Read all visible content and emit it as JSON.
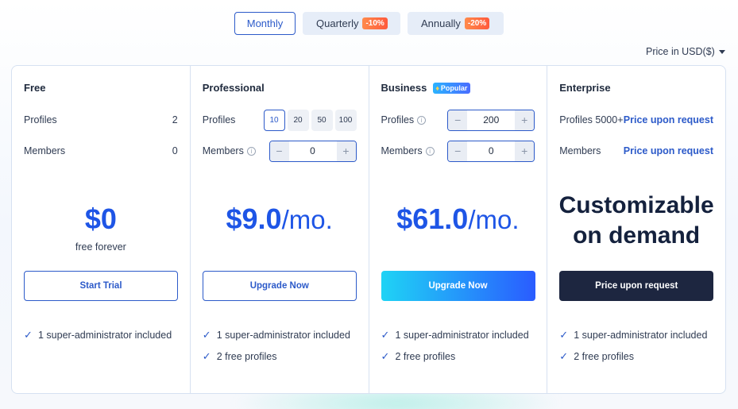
{
  "billing": {
    "options": [
      {
        "label": "Monthly"
      },
      {
        "label": "Quarterly",
        "badge": "-10%"
      },
      {
        "label": "Annually",
        "badge": "-20%"
      }
    ],
    "selected": "Monthly"
  },
  "currency": {
    "label": "Price in USD($)"
  },
  "plans": [
    {
      "name": "Free",
      "profiles_label": "Profiles",
      "profiles_value": "2",
      "members_label": "Members",
      "members_value": "0",
      "price": "$0",
      "price_sub": "free forever",
      "cta": "Start Trial",
      "features": [
        "1 super-administrator included"
      ]
    },
    {
      "name": "Professional",
      "profiles_label": "Profiles",
      "profile_options": [
        "10",
        "20",
        "50",
        "100"
      ],
      "profile_selected": "10",
      "members_label": "Members",
      "members_value": "0",
      "price": "$9.0",
      "price_unit": "/mo.",
      "cta": "Upgrade Now",
      "features": [
        "1 super-administrator included",
        "2 free profiles"
      ]
    },
    {
      "name": "Business",
      "badge": "Popular",
      "profiles_label": "Profiles",
      "profiles_value": "200",
      "members_label": "Members",
      "members_value": "0",
      "price": "$61.0",
      "price_unit": "/mo.",
      "cta": "Upgrade Now",
      "features": [
        "1 super-administrator included",
        "2 free profiles"
      ]
    },
    {
      "name": "Enterprise",
      "profiles_label": "Profiles 5000+",
      "profiles_link": "Price upon request",
      "members_label": "Members",
      "members_link": "Price upon request",
      "headline_1": "Customizable",
      "headline_2": "on demand",
      "cta": "Price upon request",
      "features": [
        "1 super-administrator included",
        "2 free profiles"
      ]
    }
  ],
  "icons": {
    "check": "check-icon",
    "info": "info-icon",
    "minus": "minus-icon",
    "plus": "plus-icon",
    "caret": "caret-down-icon",
    "flame": "flame-icon"
  },
  "colors": {
    "accent": "#2c5ac9",
    "price": "#1e55e6",
    "dark_cta": "#1d2640",
    "badge": "#ff6a40"
  }
}
